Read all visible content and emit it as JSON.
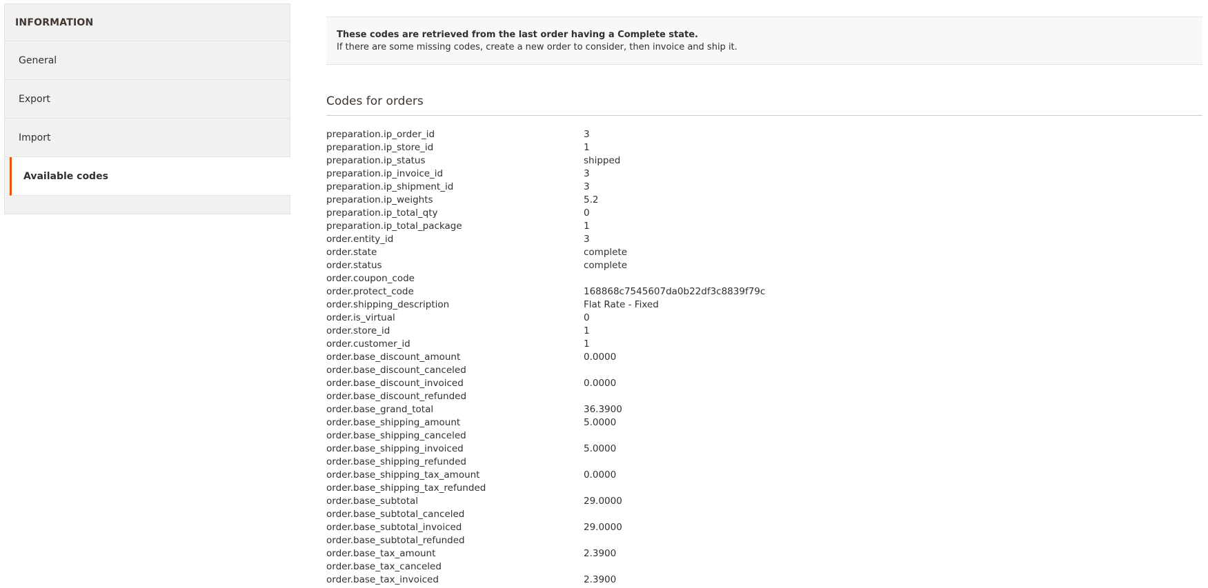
{
  "sidebar": {
    "header": "INFORMATION",
    "items": [
      {
        "label": "General"
      },
      {
        "label": "Export"
      },
      {
        "label": "Import"
      },
      {
        "label": "Available codes"
      }
    ]
  },
  "notice": {
    "strong": "These codes are retrieved from the last order having a Complete state.",
    "text": "If there are some missing codes, create a new order to consider, then invoice and ship it."
  },
  "section": {
    "title": "Codes for orders"
  },
  "codes": [
    {
      "key": "preparation.ip_order_id",
      "value": "3"
    },
    {
      "key": "preparation.ip_store_id",
      "value": "1"
    },
    {
      "key": "preparation.ip_status",
      "value": "shipped"
    },
    {
      "key": "preparation.ip_invoice_id",
      "value": "3"
    },
    {
      "key": "preparation.ip_shipment_id",
      "value": "3"
    },
    {
      "key": "preparation.ip_weights",
      "value": "5.2"
    },
    {
      "key": "preparation.ip_total_qty",
      "value": "0"
    },
    {
      "key": "preparation.ip_total_package",
      "value": "1"
    },
    {
      "key": "order.entity_id",
      "value": "3"
    },
    {
      "key": "order.state",
      "value": "complete"
    },
    {
      "key": "order.status",
      "value": "complete"
    },
    {
      "key": "order.coupon_code",
      "value": ""
    },
    {
      "key": "order.protect_code",
      "value": "168868c7545607da0b22df3c8839f79c"
    },
    {
      "key": "order.shipping_description",
      "value": "Flat Rate - Fixed"
    },
    {
      "key": "order.is_virtual",
      "value": "0"
    },
    {
      "key": "order.store_id",
      "value": "1"
    },
    {
      "key": "order.customer_id",
      "value": "1"
    },
    {
      "key": "order.base_discount_amount",
      "value": "0.0000"
    },
    {
      "key": "order.base_discount_canceled",
      "value": ""
    },
    {
      "key": "order.base_discount_invoiced",
      "value": "0.0000"
    },
    {
      "key": "order.base_discount_refunded",
      "value": ""
    },
    {
      "key": "order.base_grand_total",
      "value": "36.3900"
    },
    {
      "key": "order.base_shipping_amount",
      "value": "5.0000"
    },
    {
      "key": "order.base_shipping_canceled",
      "value": ""
    },
    {
      "key": "order.base_shipping_invoiced",
      "value": "5.0000"
    },
    {
      "key": "order.base_shipping_refunded",
      "value": ""
    },
    {
      "key": "order.base_shipping_tax_amount",
      "value": "0.0000"
    },
    {
      "key": "order.base_shipping_tax_refunded",
      "value": ""
    },
    {
      "key": "order.base_subtotal",
      "value": "29.0000"
    },
    {
      "key": "order.base_subtotal_canceled",
      "value": ""
    },
    {
      "key": "order.base_subtotal_invoiced",
      "value": "29.0000"
    },
    {
      "key": "order.base_subtotal_refunded",
      "value": ""
    },
    {
      "key": "order.base_tax_amount",
      "value": "2.3900"
    },
    {
      "key": "order.base_tax_canceled",
      "value": ""
    },
    {
      "key": "order.base_tax_invoiced",
      "value": "2.3900"
    }
  ],
  "colors": {
    "accent": "#eb5202",
    "sidebar_bg": "#f1f1f1",
    "notice_bg": "#f8f8f8"
  }
}
